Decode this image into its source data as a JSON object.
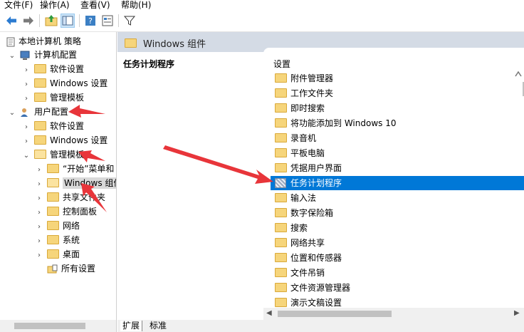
{
  "menu": [
    "文件(F)",
    "操作(A)",
    "查看(V)",
    "帮助(H)"
  ],
  "toolbar": {
    "icons": [
      "back-arrow-icon",
      "forward-arrow-icon",
      "up-folder-icon",
      "show-hide-tree-icon",
      "help-icon",
      "properties-icon",
      "filter-icon"
    ]
  },
  "tree": {
    "root": "本地计算机 策略",
    "computer_config": "计算机配置",
    "cc_software": "软件设置",
    "cc_windows": "Windows 设置",
    "cc_admin": "管理模板",
    "user_config": "用户配置",
    "uc_software": "软件设置",
    "uc_windows": "Windows 设置",
    "uc_admin": "管理模板",
    "start_menu": "“开始”菜单和",
    "windows_components": "Windows 组件",
    "shared_folders": "共享文件夹",
    "control_panel": "控制面板",
    "network": "网络",
    "system": "系统",
    "desktop": "桌面",
    "all_settings": "所有设置"
  },
  "right": {
    "header": "Windows 组件",
    "description_title": "任务计划程序",
    "column_header": "设置",
    "items": [
      "附件管理器",
      "工作文件夹",
      "即时搜索",
      "将功能添加到 Windows 10",
      "录音机",
      "平板电脑",
      "凭据用户界面",
      "任务计划程序",
      "输入法",
      "数字保险箱",
      "搜索",
      "网络共享",
      "位置和传感器",
      "文件吊销",
      "文件资源管理器",
      "演示文稿设置"
    ],
    "selected_index": 7
  },
  "tabs": {
    "extended": "扩展",
    "standard": "标准"
  },
  "colors": {
    "selection": "#0078d7",
    "header_band": "#d4dbe5",
    "arrow": "#e8353a"
  }
}
